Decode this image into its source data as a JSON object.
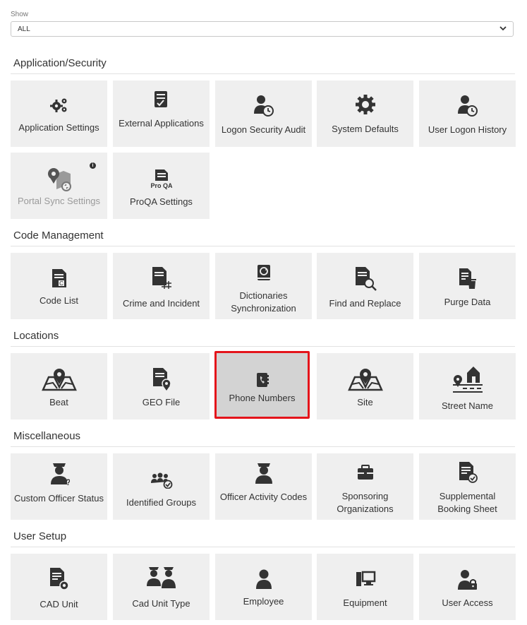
{
  "show": {
    "label": "Show",
    "value": "ALL"
  },
  "sections": {
    "app_security": {
      "title": "Application/Security",
      "tiles": [
        {
          "label": "Application Settings"
        },
        {
          "label": "External Applications"
        },
        {
          "label": "Logon Security Audit"
        },
        {
          "label": "System Defaults"
        },
        {
          "label": "User Logon History"
        },
        {
          "label": "Portal Sync Settings",
          "badge": "i"
        },
        {
          "label": "ProQA Settings",
          "icon_text": "Pro QA"
        }
      ]
    },
    "code_management": {
      "title": "Code Management",
      "tiles": [
        {
          "label": "Code List"
        },
        {
          "label": "Crime and Incident"
        },
        {
          "label": "Dictionaries Synchronization"
        },
        {
          "label": "Find and Replace"
        },
        {
          "label": "Purge Data"
        }
      ]
    },
    "locations": {
      "title": "Locations",
      "tiles": [
        {
          "label": "Beat"
        },
        {
          "label": "GEO File"
        },
        {
          "label": "Phone Numbers"
        },
        {
          "label": "Site"
        },
        {
          "label": "Street Name"
        }
      ]
    },
    "miscellaneous": {
      "title": "Miscellaneous",
      "tiles": [
        {
          "label": "Custom Officer Status"
        },
        {
          "label": "Identified Groups"
        },
        {
          "label": "Officer Activity Codes"
        },
        {
          "label": "Sponsoring Organizations"
        },
        {
          "label": "Supplemental Booking Sheet"
        }
      ]
    },
    "user_setup": {
      "title": "User Setup",
      "tiles": [
        {
          "label": "CAD Unit"
        },
        {
          "label": "Cad Unit Type"
        },
        {
          "label": "Employee"
        },
        {
          "label": "Equipment"
        },
        {
          "label": "User Access"
        }
      ]
    }
  },
  "colors": {
    "tile_bg": "#efefef",
    "selected_border": "#e4141b",
    "selected_bg": "#d3d3d3",
    "icon": "#333333"
  }
}
